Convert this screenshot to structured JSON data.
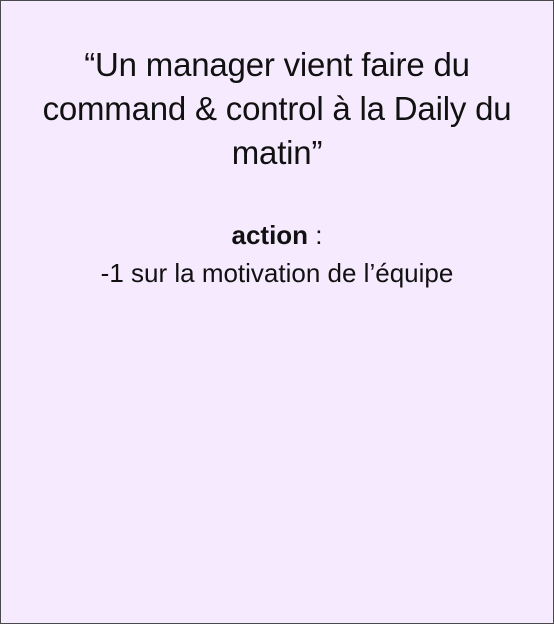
{
  "card": {
    "background_color": "#f6eafe",
    "border_color": "#4a4a4a",
    "quote": "“Un manager vient faire du command & control à la Daily du matin”",
    "action": {
      "label": "action",
      "separator": " :"
    },
    "effect": "-1 sur la motivation de l’équipe"
  }
}
